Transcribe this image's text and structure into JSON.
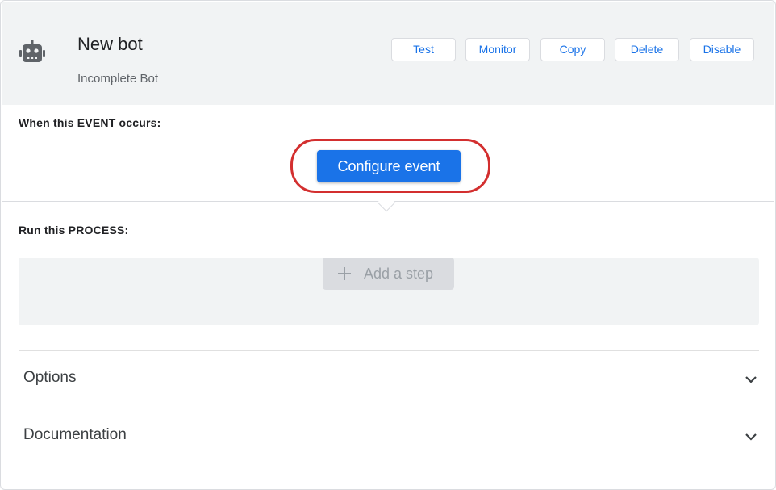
{
  "header": {
    "title": "New bot",
    "subtitle": "Incomplete Bot",
    "icon": "robot-icon",
    "actions": [
      {
        "label": "Test"
      },
      {
        "label": "Monitor"
      },
      {
        "label": "Copy"
      },
      {
        "label": "Delete"
      },
      {
        "label": "Disable"
      }
    ]
  },
  "event": {
    "label": "When this EVENT occurs:",
    "button_label": "Configure event"
  },
  "process": {
    "label": "Run this PROCESS:",
    "add_step_label": "Add a step"
  },
  "sections": [
    {
      "label": "Options",
      "icon": "chevron-down-icon"
    },
    {
      "label": "Documentation",
      "icon": "chevron-down-icon"
    }
  ],
  "colors": {
    "primary": "#1a73e8",
    "header_bg": "#f1f3f4",
    "highlight": "#d32f2f",
    "disabled_bg": "#dadce0"
  }
}
